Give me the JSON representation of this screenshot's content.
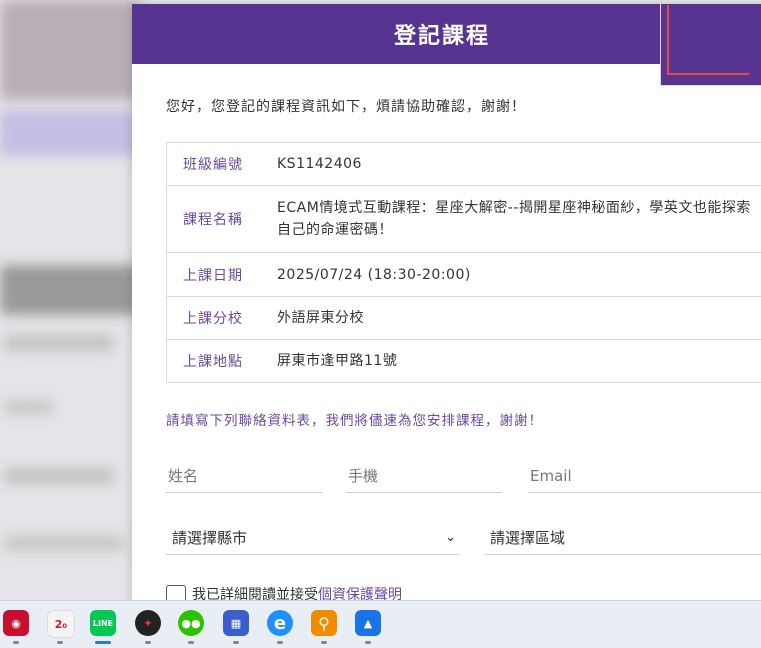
{
  "modal": {
    "title": "登記課程",
    "intro": "您好，您登記的課程資訊如下，煩請協助確認，謝謝！",
    "info": [
      {
        "label": "班級編號",
        "value": "KS1142406"
      },
      {
        "label": "課程名稱",
        "value": "ECAM情境式互動課程：星座大解密--揭開星座神秘面紗，學英文也能探索自己的命運密碼！"
      },
      {
        "label": "上課日期",
        "value": "2025/07/24 (18:30-20:00)"
      },
      {
        "label": "上課分校",
        "value": "外語屏東分校"
      },
      {
        "label": "上課地點",
        "value": "屏東市逢甲路11號"
      }
    ],
    "form_note": "請填寫下列聯絡資料表，我們將儘速為您安排課程，謝謝！",
    "fields": {
      "name_placeholder": "姓名",
      "phone_placeholder": "手機",
      "email_placeholder": "Email",
      "city_select": "請選擇縣市",
      "area_select": "請選擇區域"
    },
    "consent": {
      "text": "我已詳細閱讀並接受",
      "link": "個資保護聲明"
    }
  },
  "taskbar": {
    "apps": [
      {
        "icon": "red-emblem-icon",
        "color": "#c8102e",
        "glyph": "◉"
      },
      {
        "icon": "app-20-icon",
        "color": "#f2f2f2",
        "glyph": "2₀"
      },
      {
        "icon": "line-icon",
        "color": "#06c755",
        "glyph": "LINE"
      },
      {
        "icon": "red-black-app-icon",
        "color": "#222222",
        "glyph": "✦"
      },
      {
        "icon": "wechat-icon",
        "color": "#2dc100",
        "glyph": "💬"
      },
      {
        "icon": "grid-app-icon",
        "color": "#3a5fcd",
        "glyph": "▦"
      },
      {
        "icon": "internet-explorer-icon",
        "color": "#1e90ff",
        "glyph": "e"
      },
      {
        "icon": "search-app-icon",
        "color": "#f08c00",
        "glyph": "⚲"
      },
      {
        "icon": "photos-icon",
        "color": "#1a73e8",
        "glyph": "▲"
      }
    ]
  }
}
